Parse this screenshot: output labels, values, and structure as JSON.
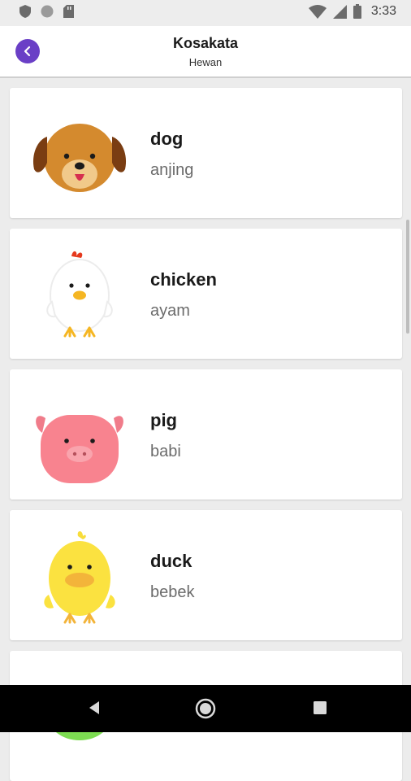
{
  "status_bar": {
    "time": "3:33",
    "left_icons": [
      "shield-icon",
      "circle-icon",
      "sd-card-icon"
    ],
    "right_icons": [
      "wifi-icon",
      "signal-icon",
      "battery-icon"
    ]
  },
  "header": {
    "title": "Kosakata",
    "subtitle": "Hewan",
    "back_icon": "chevron-left-icon",
    "accent_color": "#6a3fc6"
  },
  "vocab": [
    {
      "word": "dog",
      "meaning": "anjing",
      "icon": "dog-icon"
    },
    {
      "word": "chicken",
      "meaning": "ayam",
      "icon": "chicken-icon"
    },
    {
      "word": "pig",
      "meaning": "babi",
      "icon": "pig-icon"
    },
    {
      "word": "duck",
      "meaning": "bebek",
      "icon": "duck-icon"
    },
    {
      "word": "",
      "meaning": "",
      "icon": "frog-icon"
    }
  ],
  "nav_bar": {
    "buttons": [
      "back-triangle-icon",
      "home-circle-icon",
      "recents-square-icon"
    ]
  }
}
